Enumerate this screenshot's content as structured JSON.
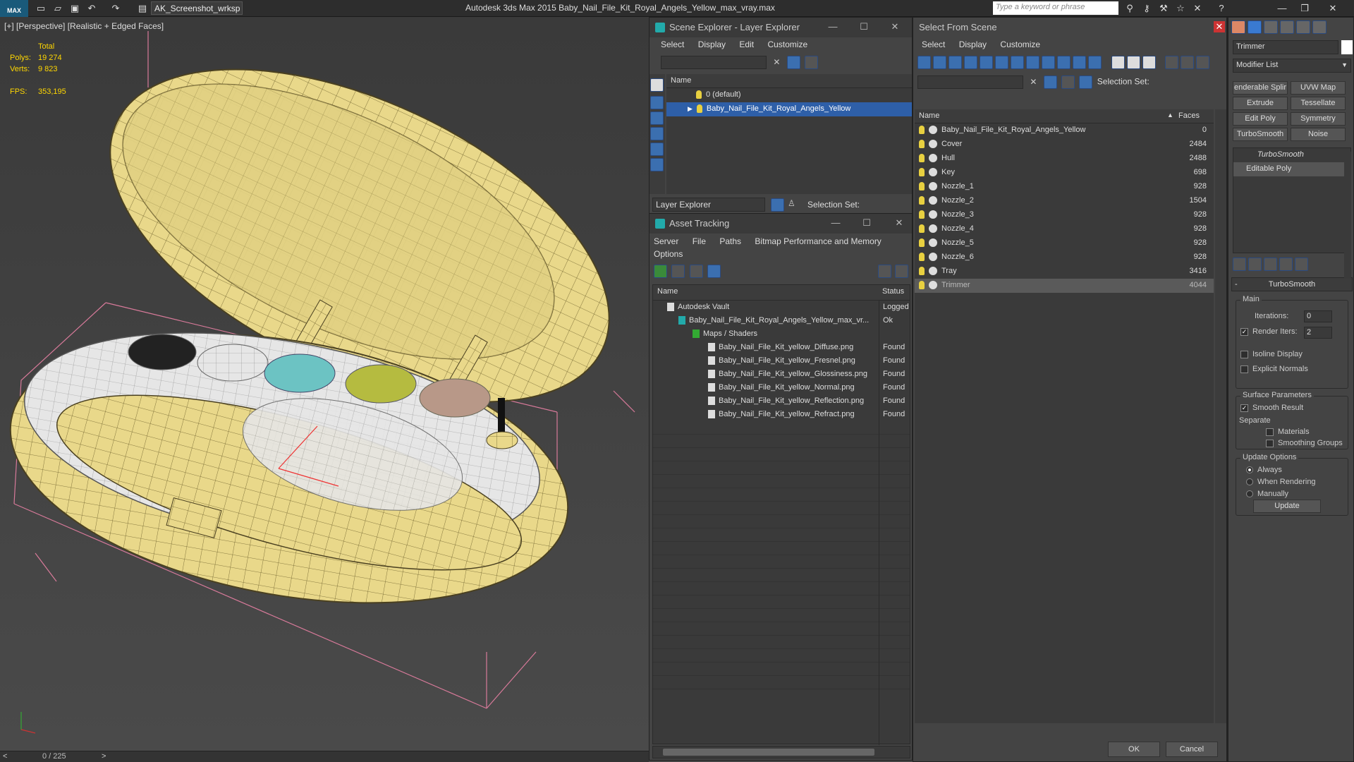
{
  "titlebar": {
    "workspace": "AK_Screenshot_wrksp",
    "app_title": "Autodesk 3ds Max  2015    Baby_Nail_File_Kit_Royal_Angels_Yellow_max_vray.max",
    "search_placeholder": "Type a keyword or phrase",
    "logo": "MAX"
  },
  "viewport": {
    "label": "[+] [Perspective] [Realistic + Edged Faces]",
    "stats": {
      "total_label": "Total",
      "polys_label": "Polys:",
      "polys_value": "19 274",
      "verts_label": "Verts:",
      "verts_value": "9 823",
      "fps_label": "FPS:",
      "fps_value": "353,195"
    }
  },
  "timeline": {
    "frame": "0 / 225",
    "prev": "<",
    "next": ">"
  },
  "scene_explorer": {
    "title": "Scene Explorer - Layer Explorer",
    "menu": [
      "Select",
      "Display",
      "Edit",
      "Customize"
    ],
    "col_name": "Name",
    "rows": [
      "0 (default)",
      "Baby_Nail_File_Kit_Royal_Angels_Yellow"
    ],
    "footer_label": "Layer Explorer",
    "selection_set": "Selection Set:"
  },
  "asset_tracking": {
    "title": "Asset Tracking",
    "menu": [
      "Server",
      "File",
      "Paths",
      "Bitmap Performance and Memory"
    ],
    "menu2": "Options",
    "col_name": "Name",
    "col_status": "Status",
    "rows": [
      {
        "name": "Autodesk Vault",
        "status": "Logged"
      },
      {
        "name": "Baby_Nail_File_Kit_Royal_Angels_Yellow_max_vr...",
        "status": "Ok"
      },
      {
        "name": "Maps / Shaders",
        "status": ""
      },
      {
        "name": "Baby_Nail_File_Kit_yellow_Diffuse.png",
        "status": "Found"
      },
      {
        "name": "Baby_Nail_File_Kit_yellow_Fresnel.png",
        "status": "Found"
      },
      {
        "name": "Baby_Nail_File_Kit_yellow_Glossiness.png",
        "status": "Found"
      },
      {
        "name": "Baby_Nail_File_Kit_yellow_Normal.png",
        "status": "Found"
      },
      {
        "name": "Baby_Nail_File_Kit_yellow_Reflection.png",
        "status": "Found"
      },
      {
        "name": "Baby_Nail_File_Kit_yellow_Refract.png",
        "status": "Found"
      }
    ]
  },
  "select_from_scene": {
    "title": "Select From Scene",
    "menu": [
      "Select",
      "Display",
      "Customize"
    ],
    "selection_set": "Selection Set:",
    "col_name": "Name",
    "col_faces": "Faces",
    "rows": [
      {
        "name": "Baby_Nail_File_Kit_Royal_Angels_Yellow",
        "faces": "0"
      },
      {
        "name": "Cover",
        "faces": "2484"
      },
      {
        "name": "Hull",
        "faces": "2488"
      },
      {
        "name": "Key",
        "faces": "698"
      },
      {
        "name": "Nozzle_1",
        "faces": "928"
      },
      {
        "name": "Nozzle_2",
        "faces": "1504"
      },
      {
        "name": "Nozzle_3",
        "faces": "928"
      },
      {
        "name": "Nozzle_4",
        "faces": "928"
      },
      {
        "name": "Nozzle_5",
        "faces": "928"
      },
      {
        "name": "Nozzle_6",
        "faces": "928"
      },
      {
        "name": "Tray",
        "faces": "3416"
      },
      {
        "name": "Trimmer",
        "faces": "4044"
      }
    ],
    "ok": "OK",
    "cancel": "Cancel"
  },
  "command_panel": {
    "object_name": "Trimmer",
    "modifier_list": "Modifier List",
    "buttons": [
      "enderable Splir",
      "UVW Map",
      "Extrude",
      "Tessellate",
      "Edit Poly",
      "Symmetry",
      "TurboSmooth",
      "Noise"
    ],
    "stack": [
      "TurboSmooth",
      "Editable Poly"
    ],
    "rollout_title": "TurboSmooth",
    "main": "Main",
    "iterations_label": "Iterations:",
    "iterations_value": "0",
    "render_iters_label": "Render Iters:",
    "render_iters_value": "2",
    "isoline": "Isoline Display",
    "explicit_normals": "Explicit Normals",
    "surface_params": "Surface Parameters",
    "smooth_result": "Smooth Result",
    "separate": "Separate",
    "materials": "Materials",
    "smoothing_groups": "Smoothing Groups",
    "update_options": "Update Options",
    "always": "Always",
    "when_rendering": "When Rendering",
    "manually": "Manually",
    "update": "Update"
  }
}
